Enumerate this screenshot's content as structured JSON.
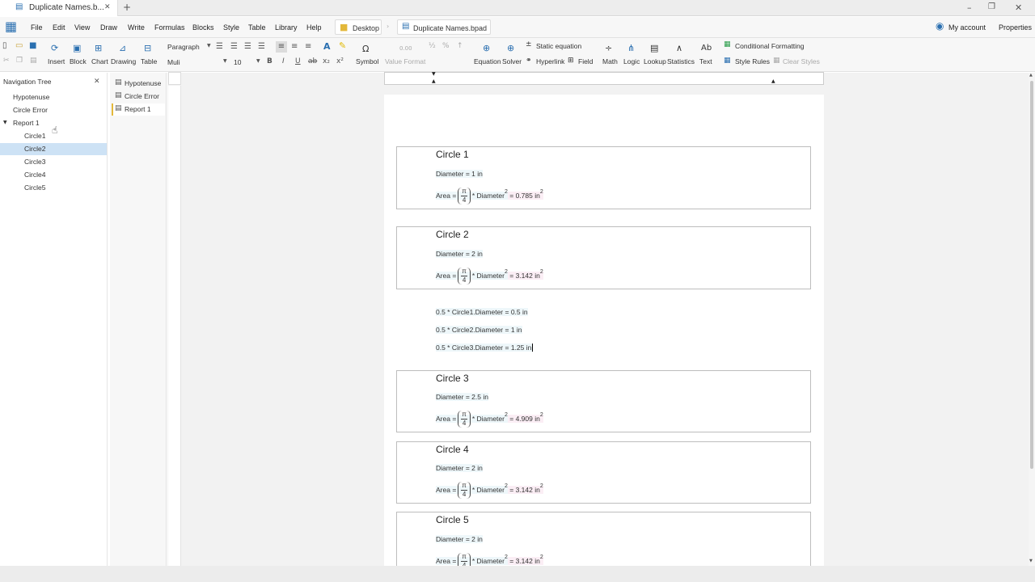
{
  "window": {
    "tab_title": "Duplicate Names.b...",
    "new_tab": "+",
    "controls": {
      "minimize": "–",
      "restore": "❐",
      "close": "✕"
    }
  },
  "menu": {
    "items": [
      "File",
      "Edit",
      "View",
      "Draw",
      "Write",
      "Formulas",
      "Blocks",
      "Style",
      "Table",
      "Library",
      "Help"
    ],
    "breadcrumb": {
      "folder": "Desktop",
      "file": "Duplicate Names.bpad"
    },
    "my_account": "My account",
    "properties": "Properties"
  },
  "ribbon": {
    "insert": "Insert",
    "block": "Block",
    "chart": "Chart",
    "drawing": "Drawing",
    "table": "Table",
    "paragraph_style": "Paragraph",
    "font": "Muli",
    "font_size": "10",
    "symbol": "Symbol",
    "value_format": "Value Format",
    "equation": "Equation",
    "solver": "Solver",
    "static_equation": "Static equation",
    "hyperlink": "Hyperlink",
    "field": "Field",
    "math": "Math",
    "logic": "Logic",
    "lookup": "Lookup",
    "statistics": "Statistics",
    "text": "Text",
    "conditional_formatting": "Conditional Formatting",
    "style_rules": "Style Rules",
    "clear_styles": "Clear Styles",
    "value_format_glyph": "0.00",
    "frac_glyph": "½",
    "percent_glyph": "%"
  },
  "navigation": {
    "title": "Navigation Tree",
    "items": [
      {
        "label": "Hypotenuse",
        "level": 0
      },
      {
        "label": "Circle Error",
        "level": 0
      },
      {
        "label": "Report 1",
        "level": 0
      },
      {
        "label": "Circle1",
        "level": 1
      },
      {
        "label": "Circle2",
        "level": 1,
        "selected": true
      },
      {
        "label": "Circle3",
        "level": 1
      },
      {
        "label": "Circle4",
        "level": 1
      },
      {
        "label": "Circle5",
        "level": 1
      }
    ]
  },
  "pages": [
    "Hypotenuse",
    "Circle Error",
    "Report 1"
  ],
  "document": {
    "circles": [
      {
        "title": "Circle 1",
        "diameter": "Diameter = 1 in",
        "area_lhs": "Area =",
        "pi": "π",
        "den": "4",
        "area_mid": "* Diameter",
        "area_result": "= 0.785 in"
      },
      {
        "title": "Circle 2",
        "diameter": "Diameter = 2 in",
        "area_lhs": "Area =",
        "pi": "π",
        "den": "4",
        "area_mid": "* Diameter",
        "area_result": "= 3.142 in"
      },
      {
        "title": "Circle 3",
        "diameter": "Diameter = 2.5 in",
        "area_lhs": "Area =",
        "pi": "π",
        "den": "4",
        "area_mid": "* Diameter",
        "area_result": "= 4.909 in"
      },
      {
        "title": "Circle 4",
        "diameter": "Diameter = 2 in",
        "area_lhs": "Area =",
        "pi": "π",
        "den": "4",
        "area_mid": "* Diameter",
        "area_result": "= 3.142 in"
      },
      {
        "title": "Circle 5",
        "diameter": "Diameter = 2 in",
        "area_lhs": "Area =",
        "pi": "π",
        "den": "4",
        "area_mid": "* Diameter",
        "area_result": "= 3.142 in"
      }
    ],
    "exponent": "2",
    "expressions": [
      "0.5 * Circle1.Diameter = 0.5 in",
      "0.5 * Circle2.Diameter = 1 in",
      "0.5 * Circle3.Diameter = 1.25 in"
    ]
  },
  "colors": {
    "accent": "#2a6fb0",
    "selection": "#cde2f5",
    "page_bg": "#f2f2f2"
  }
}
